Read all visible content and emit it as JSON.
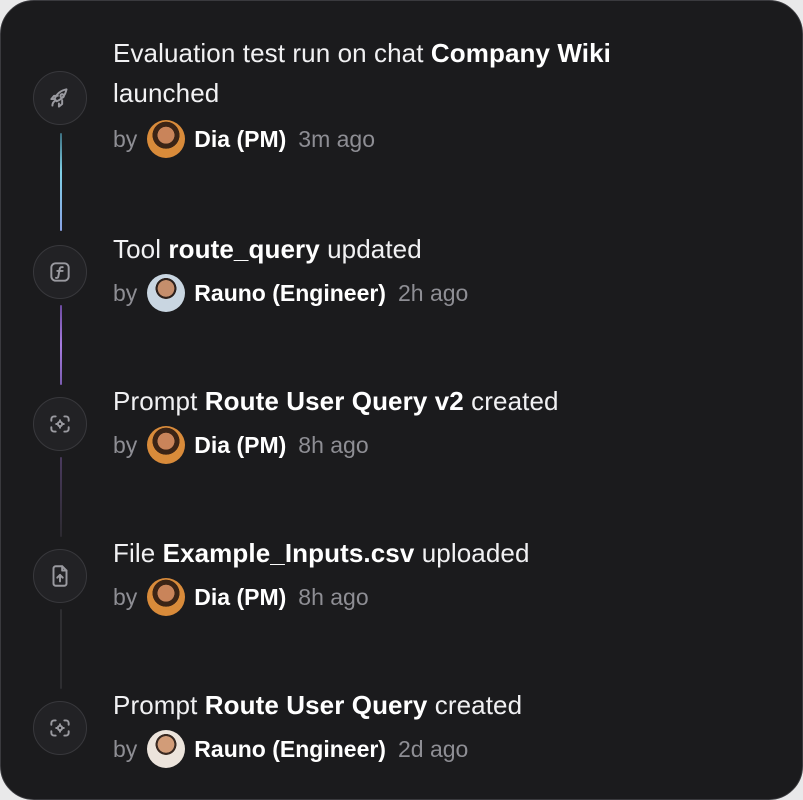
{
  "timeline": [
    {
      "icon": "rocket-icon",
      "title_pre": "Evaluation test run on chat ",
      "title_bold": "Company Wiki",
      "title_post": " launched",
      "by": "by",
      "author": "Dia (PM)",
      "time": "3m ago"
    },
    {
      "icon": "function-icon",
      "title_pre": "Tool ",
      "title_bold": "route_query",
      "title_post": " updated",
      "by": "by",
      "author": "Rauno (Engineer)",
      "time": "2h ago"
    },
    {
      "icon": "prompt-icon",
      "title_pre": "Prompt ",
      "title_bold": "Route User Query v2",
      "title_post": " created",
      "by": "by",
      "author": "Dia (PM)",
      "time": "8h ago"
    },
    {
      "icon": "file-upload-icon",
      "title_pre": "File ",
      "title_bold": "Example_Inputs.csv",
      "title_post": " uploaded",
      "by": "by",
      "author": "Dia (PM)",
      "time": "8h ago"
    },
    {
      "icon": "prompt-icon",
      "title_pre": "Prompt ",
      "title_bold": "Route User Query",
      "title_post": " created",
      "by": "by",
      "author": "Rauno (Engineer)",
      "time": "2d ago"
    }
  ],
  "colors": {
    "line_1": "#7fd0e6",
    "line_2": "#a77ce0",
    "line_3": "#3b3346",
    "line_4": "#333336"
  }
}
